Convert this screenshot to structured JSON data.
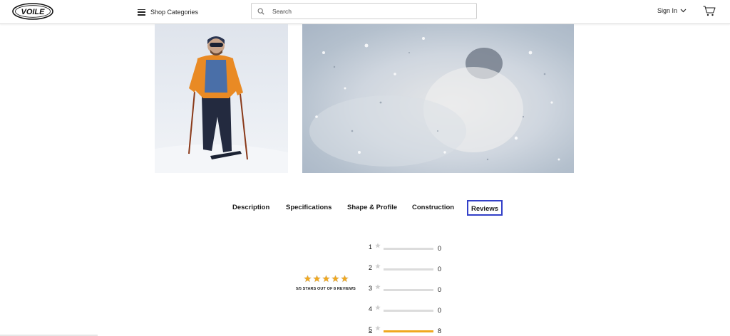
{
  "header": {
    "logo_text": "VOILE",
    "menu_label": "Shop Categories",
    "search_placeholder": "Search",
    "signin_label": "Sign In"
  },
  "tabs": [
    {
      "label": "Description",
      "active": false
    },
    {
      "label": "Specifications",
      "active": false
    },
    {
      "label": "Shape & Profile",
      "active": false
    },
    {
      "label": "Construction",
      "active": false
    },
    {
      "label": "Reviews",
      "active": true
    }
  ],
  "reviews": {
    "average_stars": 5,
    "summary": "5/5 STARS OUT OF 8 REVIEWS",
    "breakdown": [
      {
        "rating": "1",
        "count": "0",
        "fraction": 0
      },
      {
        "rating": "2",
        "count": "0",
        "fraction": 0
      },
      {
        "rating": "3",
        "count": "0",
        "fraction": 0
      },
      {
        "rating": "4",
        "count": "0",
        "fraction": 0
      },
      {
        "rating": "5",
        "count": "8",
        "fraction": 1
      }
    ]
  },
  "colors": {
    "accent_border": "#3340c8",
    "bar_fill": "#f0a81f",
    "bar_empty": "#dcdcdc",
    "star_gold": "#f0a81f"
  }
}
